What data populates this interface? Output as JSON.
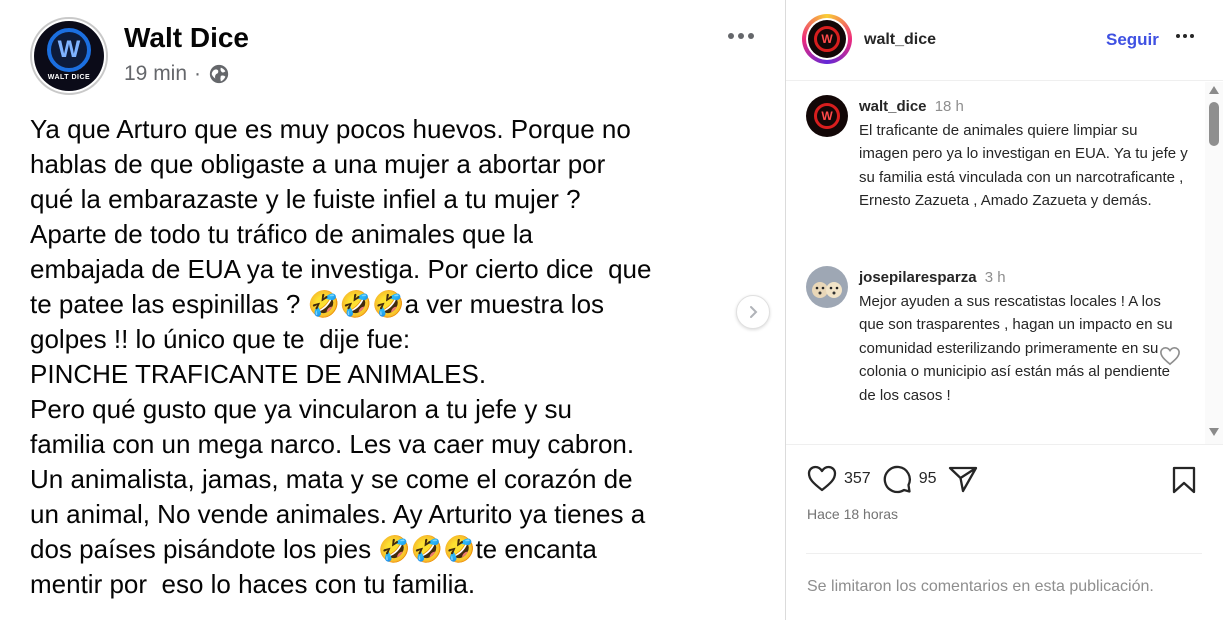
{
  "facebook_post": {
    "author": "Walt Dice",
    "avatar_logo_letter": "W",
    "avatar_logo_text": "WALT DICE",
    "time_ago": "19 min",
    "separator": "·",
    "audience_icon": "globe-icon",
    "more_icon": "more-options-icon",
    "next_icon": "chevron-right-icon",
    "body": "Ya que Arturo que es muy pocos huevos. Porque no\nhablas de que obligaste a una mujer a abortar por\nqué la embarazaste y le fuiste infiel a tu mujer ?\nAparte de todo tu tráfico de animales que la\nembajada de EUA ya te investiga. Por cierto dice  que\nte patee las espinillas ? 🤣🤣🤣a ver muestra los\ngolpes !! lo único que te  dije fue:\nPINCHE TRAFICANTE DE ANIMALES.\nPero qué gusto que ya vincularon a tu jefe y su\nfamilia con un mega narco. Les va caer muy cabron.\nUn animalista, jamas, mata y se come el corazón de\nun animal, No vende animales. Ay Arturito ya tienes a\ndos países pisándote los pies 🤣🤣🤣te encanta\nmentir por  eso lo haces con tu familia."
  },
  "instagram": {
    "header": {
      "username": "walt_dice",
      "follow_label": "Seguir",
      "more_icon": "more-options-icon"
    },
    "comments": [
      {
        "username": "walt_dice",
        "time": "18 h",
        "text": "El traficante de animales quiere limpiar su imagen pero ya lo investigan en EUA. Ya tu jefe y su familia está vinculada con un narcotraficante , Ernesto Zazueta , Amado Zazueta y demás."
      },
      {
        "username": "josepilaresparza",
        "time": "3 h",
        "text": "Mejor ayuden a sus rescatistas locales ! A los que son trasparentes , hagan un impacto en su comunidad esterilizando primeramente en su colonia o municipio así están más al pendiente de los casos !",
        "like_icon": "heart-outline-icon"
      }
    ],
    "actions": {
      "like_icon": "heart-icon",
      "likes": "357",
      "comment_icon": "comment-icon",
      "comments": "95",
      "share_icon": "send-icon",
      "save_icon": "bookmark-icon"
    },
    "date": "Hace 18 horas",
    "comments_limited": "Se limitaron los comentarios en esta publicación."
  },
  "colors": {
    "follow_blue": "#3f51e2",
    "fb_gray": "#65676b",
    "ig_gray": "#8e8e8e"
  }
}
